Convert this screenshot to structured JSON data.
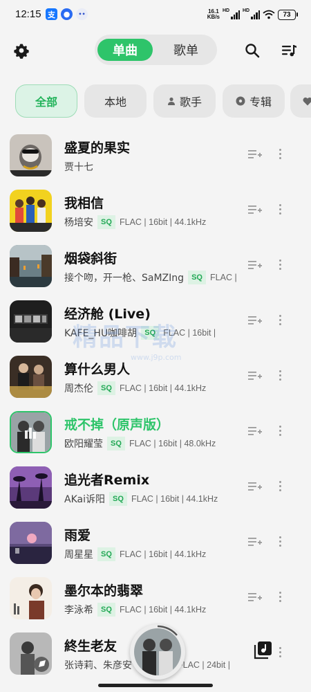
{
  "status_bar": {
    "time": "12:15",
    "net_speed_value": "16.1",
    "net_speed_unit": "KB/s",
    "signal1_label": "HD",
    "signal2_label": "HD",
    "battery": "73"
  },
  "top_bar": {
    "settings_icon": "gear-icon",
    "tabs": [
      "单曲",
      "歌单"
    ],
    "active_tab": "单曲",
    "search_icon": "search-icon",
    "queue_icon": "playlist-icon",
    "accent_color": "#2ec46a"
  },
  "filters": [
    {
      "label": "全部",
      "active": true
    },
    {
      "label": "本地",
      "active": false
    },
    {
      "label": "歌手",
      "icon": "person-icon",
      "active": false
    },
    {
      "label": "专辑",
      "icon": "disc-icon",
      "active": false
    }
  ],
  "songs": [
    {
      "title": "盛夏的果实",
      "artist": "贾十七",
      "sq": "",
      "format": ""
    },
    {
      "title": "我相信",
      "artist": "杨培安",
      "sq": "SQ",
      "format": "FLAC | 16bit | 44.1kHz"
    },
    {
      "title": "烟袋斜街",
      "artist": "接个吻，开一枪、SaMZIng",
      "sq": "SQ",
      "format": "FLAC |"
    },
    {
      "title": "经济舱 (Live)",
      "artist": "KAFE_HU咖啡胡",
      "sq": "SQ",
      "format": "FLAC | 16bit |"
    },
    {
      "title": "算什么男人",
      "artist": "周杰伦",
      "sq": "SQ",
      "format": "FLAC | 16bit | 44.1kHz"
    },
    {
      "title": "戒不掉（原声版）",
      "artist": "欧阳耀莹",
      "sq": "SQ",
      "format": "FLAC | 16bit | 48.0kHz",
      "playing": true
    },
    {
      "title": "追光者Remix",
      "artist": "AKai诉阳",
      "sq": "SQ",
      "format": "FLAC | 16bit | 44.1kHz"
    },
    {
      "title": "雨爱",
      "artist": "周星星",
      "sq": "SQ",
      "format": "FLAC | 16bit | 44.1kHz"
    },
    {
      "title": "墨尔本的翡翠",
      "artist": "李泳希",
      "sq": "SQ",
      "format": "FLAC | 16bit | 44.1kHz"
    },
    {
      "title": "終生老友",
      "artist": "张诗莉、朱彦安",
      "sq": "",
      "format": "FLAC | 24bit |"
    }
  ],
  "watermark": {
    "text": "精品下载",
    "sub": "www.j9p.com"
  }
}
